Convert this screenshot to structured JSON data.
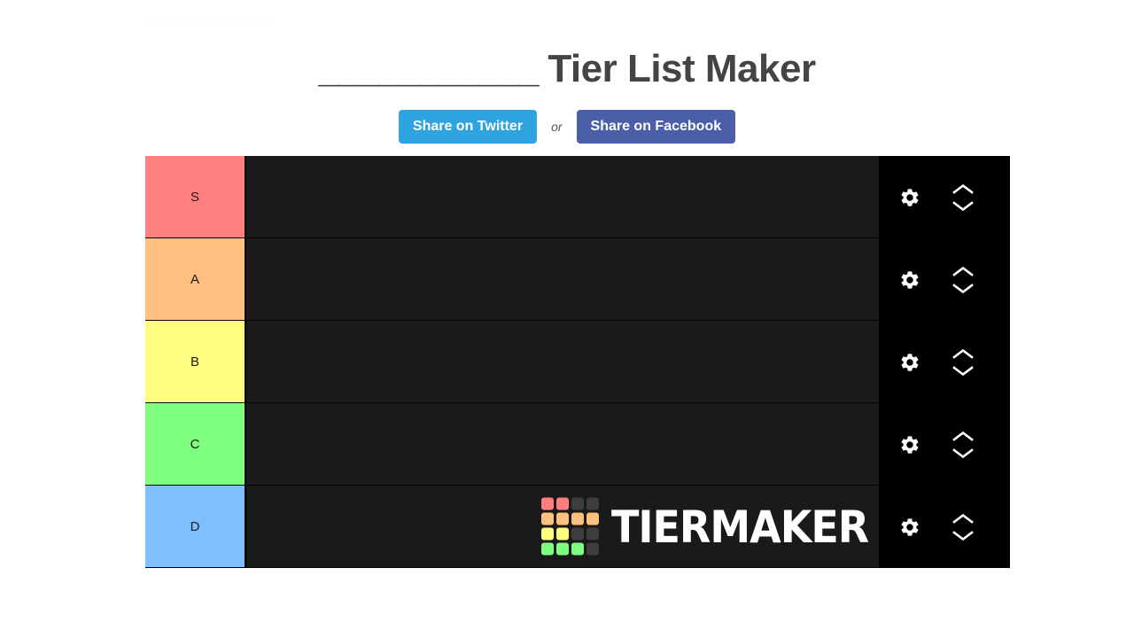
{
  "page": {
    "background": "#ffffff",
    "top_faint_text": "the most secret of secrets"
  },
  "header": {
    "title_blank": "___________",
    "title_text": " Tier List Maker"
  },
  "share": {
    "twitter_label": "Share on Twitter",
    "or_label": "or",
    "facebook_label": "Share on Facebook",
    "twitter_color": "#2da4e0",
    "facebook_color": "#4a5fa8"
  },
  "tierlist": {
    "row_background": "#1a1a1a",
    "panel_background": "#000000",
    "rows": [
      {
        "label": "S",
        "color": "#ff7f7f"
      },
      {
        "label": "A",
        "color": "#ffbf7f"
      },
      {
        "label": "B",
        "color": "#ffff7f"
      },
      {
        "label": "C",
        "color": "#7fff7f"
      },
      {
        "label": "D",
        "color": "#7fbfff"
      }
    ]
  },
  "controls": {
    "settings_icon": "gear-icon",
    "move_up_icon": "chevron-up-icon",
    "move_down_icon": "chevron-down-icon"
  },
  "logo": {
    "wordmark": "TIERMAKER",
    "grid_colors": [
      "#ff7f7f",
      "#ff7f7f",
      "#3d3d3d",
      "#3d3d3d",
      "#ffbf7f",
      "#ffbf7f",
      "#ffbf7f",
      "#ffbf7f",
      "#ffff7f",
      "#ffff7f",
      "#3d3d3d",
      "#3d3d3d",
      "#7fff7f",
      "#7fff7f",
      "#7fff7f",
      "#3d3d3d"
    ]
  }
}
